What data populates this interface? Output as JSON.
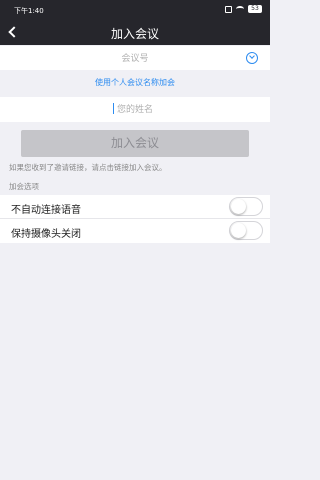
{
  "status_bar": {
    "time": "下午1:40",
    "battery": "53"
  },
  "nav": {
    "title": "加入会议"
  },
  "meeting_input": {
    "placeholder": "会议号"
  },
  "personal_link": "使用个人会议名称加会",
  "name_input": {
    "placeholder": "您的姓名"
  },
  "join_button": "加入会议",
  "hint": "如果您收到了邀请链接，请点击链接加入会议。",
  "options": {
    "section_label": "加会选项",
    "items": [
      {
        "label": "不自动连接语音",
        "on": false
      },
      {
        "label": "保持摄像头关闭",
        "on": false
      }
    ]
  },
  "colors": {
    "accent": "#2d8cf0",
    "nav_bg": "#26262c",
    "page_bg": "#f0f0f5"
  }
}
